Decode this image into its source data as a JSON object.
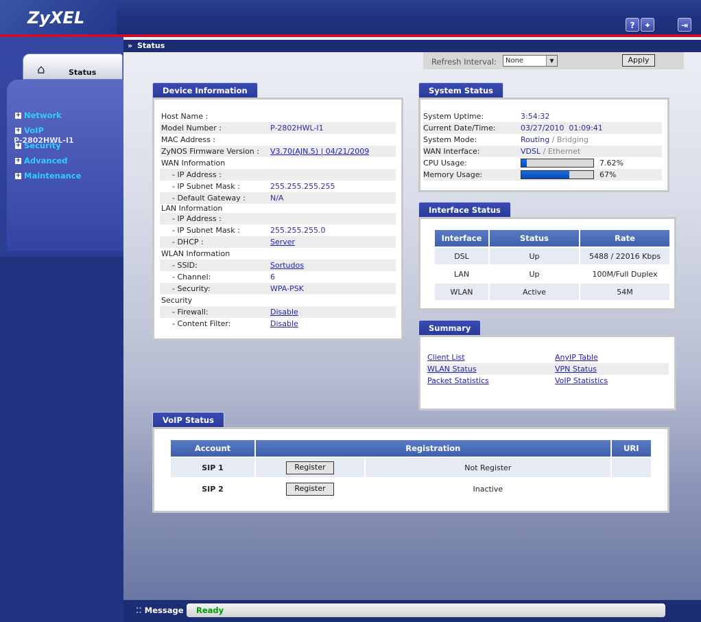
{
  "header": {
    "logo": "ZyXEL",
    "help_label": "?",
    "wizard_label": "✦",
    "logout_label": "⇥"
  },
  "sidebar": {
    "tab_label": "Status",
    "device_name": "P-2802HWL-I1",
    "items": [
      {
        "label": "Network"
      },
      {
        "label": "VoIP"
      },
      {
        "label": "Security"
      },
      {
        "label": "Advanced"
      },
      {
        "label": "Maintenance"
      }
    ]
  },
  "breadcrumb": "Status",
  "refresh": {
    "label": "Refresh Interval:",
    "value": "None",
    "apply_label": "Apply"
  },
  "device_info": {
    "title": "Device Information",
    "host_name": {
      "label": "Host Name :",
      "value": ""
    },
    "model_number": {
      "label": "Model Number :",
      "value": "P-2802HWL-I1"
    },
    "mac_address": {
      "label": "MAC Address :",
      "value": ""
    },
    "firmware": {
      "label": "ZyNOS Firmware Version :",
      "value": "V3.70(AJN.5) | 04/21/2009"
    },
    "wan_heading": "WAN Information",
    "wan_ip": {
      "label": "- IP Address :",
      "value": ""
    },
    "wan_mask": {
      "label": "- IP Subnet Mask :",
      "value": "255.255.255.255"
    },
    "wan_gateway": {
      "label": "- Default Gateway :",
      "value": "N/A"
    },
    "lan_heading": "LAN Information",
    "lan_ip": {
      "label": "- IP Address :",
      "value": ""
    },
    "lan_mask": {
      "label": "- IP Subnet Mask :",
      "value": "255.255.255.0"
    },
    "lan_dhcp": {
      "label": "- DHCP :",
      "value": "Server"
    },
    "wlan_heading": "WLAN Information",
    "wlan_ssid": {
      "label": "- SSID:",
      "value": "Sortudos"
    },
    "wlan_channel": {
      "label": "- Channel:",
      "value": "6"
    },
    "wlan_security": {
      "label": "- Security:",
      "value": "WPA-PSK"
    },
    "security_heading": "Security",
    "firewall": {
      "label": "- Firewall:",
      "value": "Disable"
    },
    "content_filter": {
      "label": "- Content Filter:",
      "value": "Disable"
    }
  },
  "system_status": {
    "title": "System Status",
    "uptime": {
      "label": "System Uptime:",
      "value": "3:54:32"
    },
    "datetime": {
      "label": "Current Date/Time:",
      "value": "03/27/2010  01:09:41"
    },
    "mode": {
      "label": "System Mode:",
      "active": "Routing",
      "sep": " / ",
      "inactive": "Bridging"
    },
    "wan_interface": {
      "label": "WAN Interface:",
      "active": "VDSL",
      "sep": " / ",
      "inactive": "Ethernet"
    },
    "cpu": {
      "label": "CPU Usage:",
      "value": "7.62%",
      "fraction": 0.0762
    },
    "memory": {
      "label": "Memory Usage:",
      "value": "67%",
      "fraction": 0.67
    }
  },
  "interface_status": {
    "title": "Interface Status",
    "headers": [
      "Interface",
      "Status",
      "Rate"
    ],
    "rows": [
      [
        "DSL",
        "Up",
        "5488 / 22016 Kbps"
      ],
      [
        "LAN",
        "Up",
        "100M/Full Duplex"
      ],
      [
        "WLAN",
        "Active",
        "54M"
      ]
    ]
  },
  "summary": {
    "title": "Summary",
    "links": [
      "Client List",
      "AnyIP Table",
      "WLAN Status",
      "VPN Status",
      "Packet Statistics",
      "VoIP Statistics"
    ]
  },
  "voip_status": {
    "title": "VoIP Status",
    "headers": [
      "Account",
      "Registration",
      "URI"
    ],
    "rows": [
      {
        "account": "SIP 1",
        "button": "Register",
        "state": "Not Register",
        "uri": ""
      },
      {
        "account": "SIP 2",
        "button": "Register",
        "state": "Inactive",
        "uri": ""
      }
    ]
  },
  "message": {
    "label": "Message",
    "value": "Ready"
  },
  "colors": {
    "header": "#1f3380",
    "accent_red": "#c8102e",
    "link": "#2020b0",
    "ready": "#009900"
  }
}
